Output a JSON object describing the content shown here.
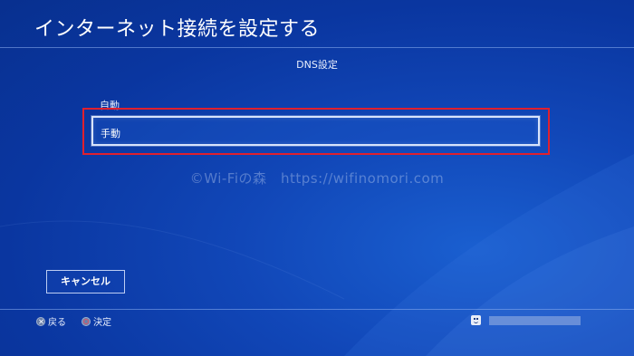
{
  "header": {
    "title": "インターネット接続を設定する"
  },
  "screen": {
    "subtitle": "DNS設定"
  },
  "options": {
    "auto_label": "自動",
    "manual_label": "手動"
  },
  "watermark": {
    "text": "©Wi-Fiの森　https://wifinomori.com"
  },
  "actions": {
    "cancel_label": "キャンセル"
  },
  "footer": {
    "back_label": "戻る",
    "confirm_label": "決定"
  },
  "icons": {
    "back_button": "cross-button-icon",
    "confirm_button": "circle-button-icon",
    "user": "user-face-icon"
  },
  "colors": {
    "highlight_frame": "#e0202e",
    "background": "#0a36a0",
    "selection_border": "#d8e3fb"
  }
}
